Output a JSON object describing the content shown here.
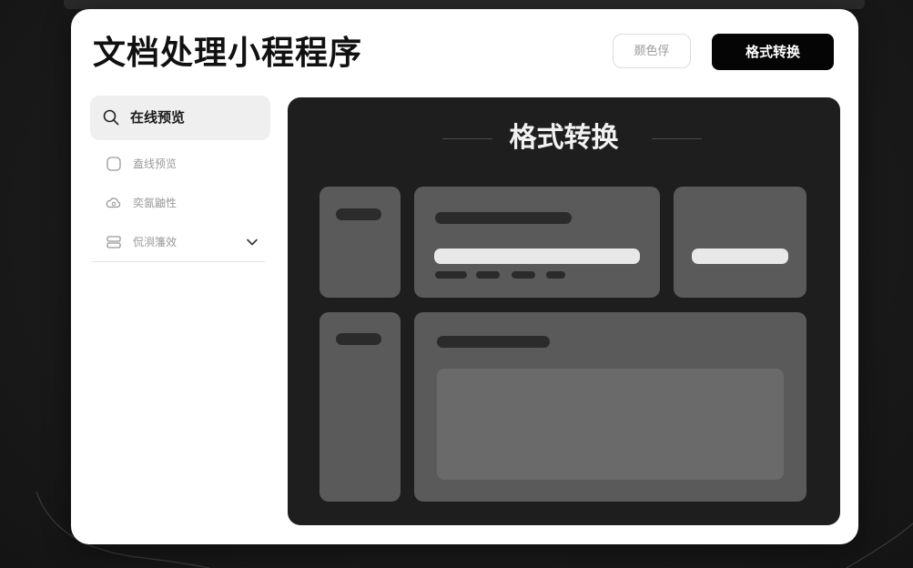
{
  "app": {
    "title": "文档处理小程程序"
  },
  "header": {
    "secondary_button_label": "颞色俘",
    "primary_button_label": "格式转换"
  },
  "sidebar": {
    "search": {
      "label": "在线预览",
      "icon": "search-icon"
    },
    "items": [
      {
        "label": "盍线预览",
        "icon": "square-icon"
      },
      {
        "label": "奕氤鼬性",
        "icon": "cloud-icon"
      },
      {
        "label": "侃㵰籓效",
        "icon": "list-icon",
        "has_chevron": true
      }
    ]
  },
  "main": {
    "panel_title": "格式转换"
  },
  "colors": {
    "card_bg": "#ffffff",
    "page_bg": "#1a1a1a",
    "panel_bg": "#1e1e1e",
    "tile_bg": "#5a5a5a",
    "primary_button_bg": "#050505"
  }
}
